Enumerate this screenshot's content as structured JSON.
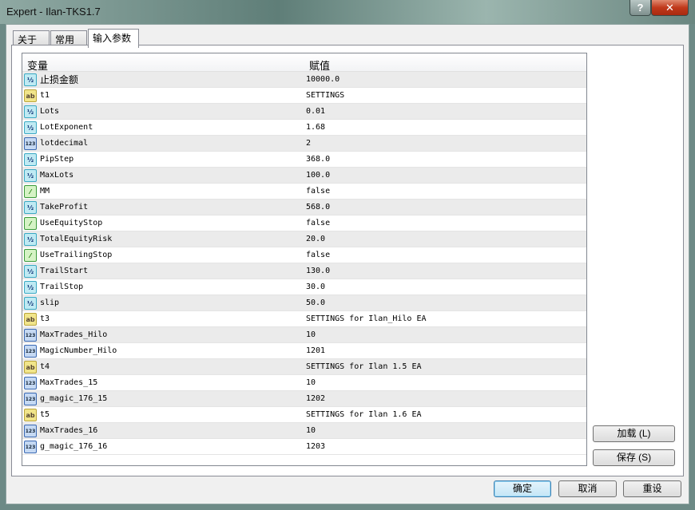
{
  "window": {
    "title": "Expert - Ilan-TKS1.7",
    "help": "?",
    "close": "✕"
  },
  "tabs": [
    {
      "label": "关于"
    },
    {
      "label": "常用"
    },
    {
      "label": "输入参数"
    }
  ],
  "table": {
    "headers": [
      "变量",
      "赋值"
    ],
    "rows": [
      {
        "icon": "double",
        "name": "止损金额",
        "value": "10000.0"
      },
      {
        "icon": "string",
        "name": "t1",
        "value": "SETTINGS"
      },
      {
        "icon": "double",
        "name": "Lots",
        "value": "0.01"
      },
      {
        "icon": "double",
        "name": "LotExponent",
        "value": "1.68"
      },
      {
        "icon": "int",
        "name": "lotdecimal",
        "value": "2"
      },
      {
        "icon": "double",
        "name": "PipStep",
        "value": "368.0"
      },
      {
        "icon": "double",
        "name": "MaxLots",
        "value": "100.0"
      },
      {
        "icon": "bool",
        "name": "MM",
        "value": "false"
      },
      {
        "icon": "double",
        "name": "TakeProfit",
        "value": "568.0"
      },
      {
        "icon": "bool",
        "name": "UseEquityStop",
        "value": "false"
      },
      {
        "icon": "double",
        "name": "TotalEquityRisk",
        "value": "20.0"
      },
      {
        "icon": "bool",
        "name": "UseTrailingStop",
        "value": "false"
      },
      {
        "icon": "double",
        "name": "TrailStart",
        "value": "130.0"
      },
      {
        "icon": "double",
        "name": "TrailStop",
        "value": "30.0"
      },
      {
        "icon": "double",
        "name": "slip",
        "value": "50.0"
      },
      {
        "icon": "string",
        "name": "t3",
        "value": "SETTINGS for Ilan_Hilo EA"
      },
      {
        "icon": "int",
        "name": "MaxTrades_Hilo",
        "value": "10"
      },
      {
        "icon": "int",
        "name": "MagicNumber_Hilo",
        "value": "1201"
      },
      {
        "icon": "string",
        "name": "t4",
        "value": "SETTINGS for Ilan 1.5 EA"
      },
      {
        "icon": "int",
        "name": "MaxTrades_15",
        "value": "10"
      },
      {
        "icon": "int",
        "name": "g_magic_176_15",
        "value": "1202"
      },
      {
        "icon": "string",
        "name": "t5",
        "value": "SETTINGS for Ilan 1.6 EA"
      },
      {
        "icon": "int",
        "name": "MaxTrades_16",
        "value": "10"
      },
      {
        "icon": "int",
        "name": "g_magic_176_16",
        "value": "1203"
      }
    ]
  },
  "icon_glyphs": {
    "double": "½",
    "string": "ab",
    "int": "123",
    "bool": "⁄"
  },
  "buttons": {
    "load": "加载 (L)",
    "save": "保存 (S)",
    "ok": "确定",
    "cancel": "取消",
    "reset": "重设"
  }
}
